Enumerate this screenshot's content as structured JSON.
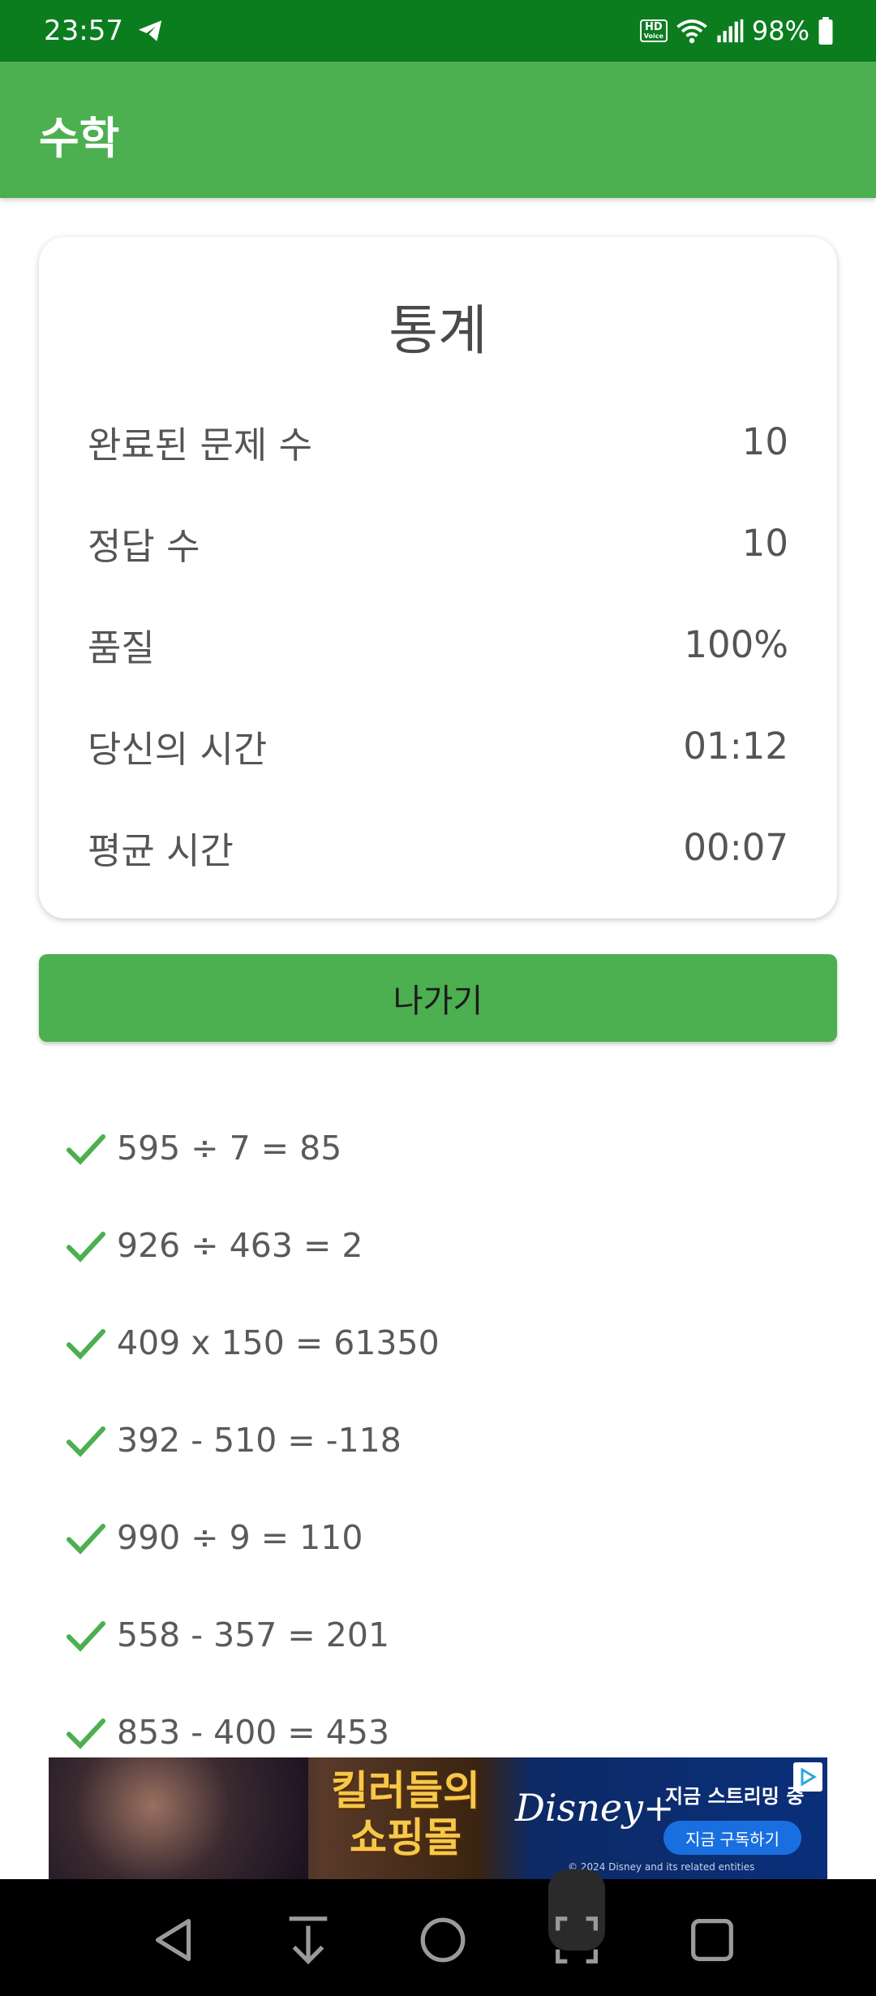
{
  "status_bar": {
    "time": "23:57",
    "hd_voice_top": "HD",
    "hd_voice_bottom": "Voice",
    "battery": "98%"
  },
  "app_bar": {
    "title": "수학"
  },
  "stats": {
    "title": "통계",
    "rows": [
      {
        "label": "완료된 문제 수",
        "value": "10"
      },
      {
        "label": "정답 수",
        "value": "10"
      },
      {
        "label": "품질",
        "value": "100%"
      },
      {
        "label": "당신의 시간",
        "value": "01:12"
      },
      {
        "label": "평균 시간",
        "value": "00:07"
      }
    ]
  },
  "exit_button": {
    "label": "나가기"
  },
  "results": [
    {
      "equation": "595 ÷ 7 = 85",
      "status": "correct"
    },
    {
      "equation": "926 ÷ 463 = 2",
      "status": "correct"
    },
    {
      "equation": "409 x 150 = 61350",
      "status": "correct"
    },
    {
      "equation": "392 - 510 = -118",
      "status": "correct"
    },
    {
      "equation": "990 ÷ 9 = 110",
      "status": "correct"
    },
    {
      "equation": "558 - 357 = 201",
      "status": "correct"
    },
    {
      "equation": "853 - 400 = 453",
      "status": "correct"
    }
  ],
  "ad": {
    "title_line1": "킬러들의",
    "title_line2": "쇼핑몰",
    "brand": "Disney+",
    "cta_top": "지금 스트리밍 중",
    "cta_button": "지금 구독하기",
    "legal": "© 2024 Disney and its related entities"
  },
  "colors": {
    "status_bar": "#0b7d1f",
    "app_bar": "#4caf50",
    "check": "#4caf50",
    "nav_bar": "#000000"
  },
  "icons": {
    "status_left": "telegram-send-icon",
    "status_right": [
      "hd-voice-icon",
      "wifi-icon",
      "signal-icon",
      "battery-icon"
    ],
    "nav": [
      "back-icon",
      "download-icon",
      "home-icon",
      "screenshot-icon",
      "recents-icon"
    ]
  }
}
